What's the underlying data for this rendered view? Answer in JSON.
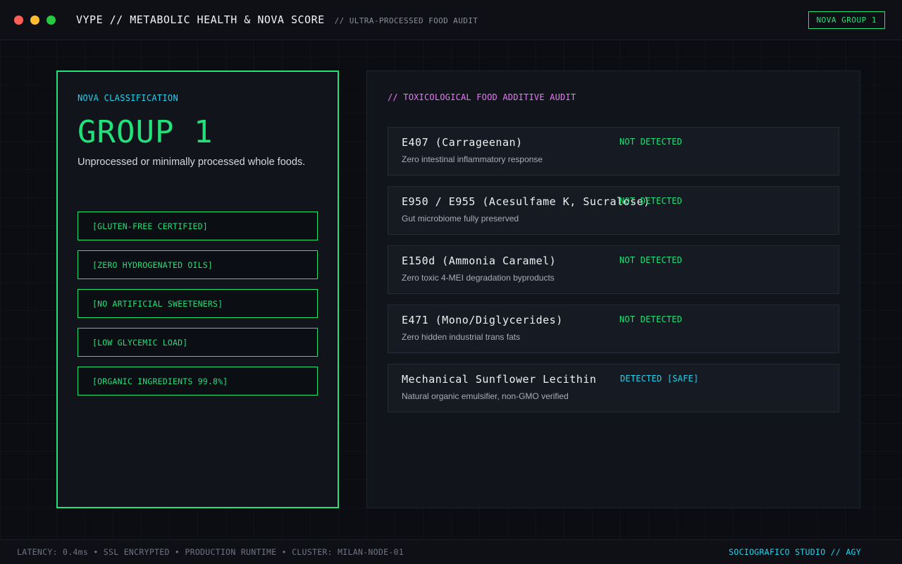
{
  "window": {
    "controls": [
      "close",
      "minimize",
      "maximize"
    ],
    "title": "VYPE // METABOLIC HEALTH & NOVA SCORE",
    "subtitle": "// ULTRA-PROCESSED FOOD AUDIT",
    "status_pill": "NOVA GROUP 1"
  },
  "classification": {
    "label": "NOVA CLASSIFICATION",
    "group": "GROUP 1",
    "description": "Unprocessed or minimally processed whole foods.",
    "badges": [
      "[GLUTEN-FREE CERTIFIED]",
      "[ZERO HYDROGENATED OILS]",
      "[NO ARTIFICIAL SWEETENERS]",
      "[LOW GLYCEMIC LOAD]",
      "[ORGANIC INGREDIENTS 99.8%]"
    ]
  },
  "audit": {
    "label": "// TOXICOLOGICAL FOOD ADDITIVE AUDIT",
    "items": [
      {
        "name": "E407 (Carrageenan)",
        "note": "Zero intestinal inflammatory response",
        "status": "NOT DETECTED"
      },
      {
        "name": "E950 / E955 (Acesulfame K, Sucralose)",
        "note": "Gut microbiome fully preserved",
        "status": "NOT DETECTED"
      },
      {
        "name": "E150d (Ammonia Caramel)",
        "note": "Zero toxic 4-MEI degradation byproducts",
        "status": "NOT DETECTED"
      },
      {
        "name": "E471 (Mono/Diglycerides)",
        "note": "Zero hidden industrial trans fats",
        "status": "NOT DETECTED"
      },
      {
        "name": "Mechanical Sunflower Lecithin",
        "note": "Natural organic emulsifier, non-GMO verified",
        "status": "DETECTED [SAFE]"
      }
    ]
  },
  "footer": {
    "left": "LATENCY: 0.4ms • SSL ENCRYPTED • PRODUCTION RUNTIME • CLUSTER: MILAN-NODE-01",
    "right": "SOCIOGRAFICO STUDIO // AGY"
  },
  "colors": {
    "accent_green": "#22e07a",
    "accent_cyan": "#22d3ee",
    "accent_magenta": "#e879f9",
    "background": "#0b0d12",
    "panel": "#11141b"
  }
}
